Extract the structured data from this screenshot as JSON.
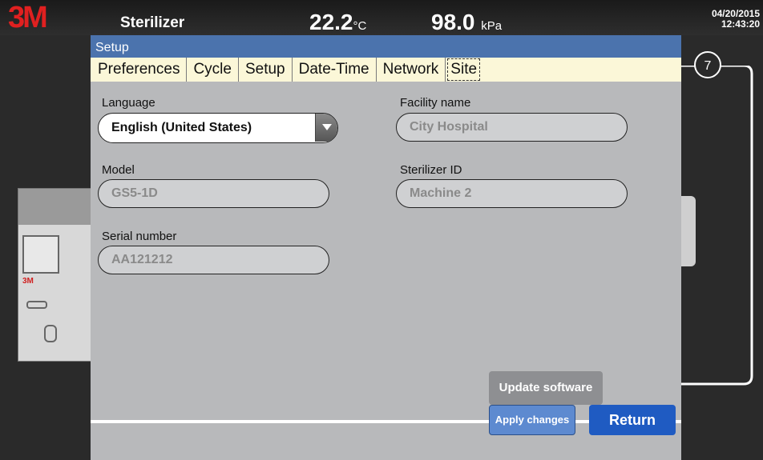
{
  "topbar": {
    "logo": "3M",
    "title": "Sterilizer",
    "temperature": {
      "value": "22.2",
      "unit": "°C"
    },
    "pressure": {
      "value": "98.0",
      "unit": "kPa"
    },
    "date": "04/20/2015",
    "time": "12:43:20"
  },
  "machine": {
    "logo": "3M"
  },
  "dialog": {
    "title": "Setup",
    "tabs": [
      {
        "label": "Preferences"
      },
      {
        "label": "Cycle"
      },
      {
        "label": "Setup"
      },
      {
        "label": "Date-Time"
      },
      {
        "label": "Network"
      },
      {
        "label": "Site"
      }
    ],
    "active_tab": "Site",
    "fields": {
      "language": {
        "label": "Language",
        "value": "English (United States)"
      },
      "facility_name": {
        "label": "Facility name",
        "value": "City Hospital"
      },
      "model": {
        "label": "Model",
        "value": "GS5-1D"
      },
      "sterilizer_id": {
        "label": "Sterilizer ID",
        "value": "Machine 2"
      },
      "serial_number": {
        "label": "Serial number",
        "value": "AA121212"
      }
    },
    "buttons": {
      "update_software": "Update software",
      "apply_changes": "Apply changes",
      "return": "Return"
    }
  },
  "callout": {
    "number": "7"
  },
  "colors": {
    "title_bar": "#4b73ad",
    "tab_bar": "#fbf7d8",
    "panel": "#b8b9bb",
    "return_button": "#1f5bc2",
    "apply_button": "#5d8ad0",
    "brand_red": "#e02020"
  }
}
